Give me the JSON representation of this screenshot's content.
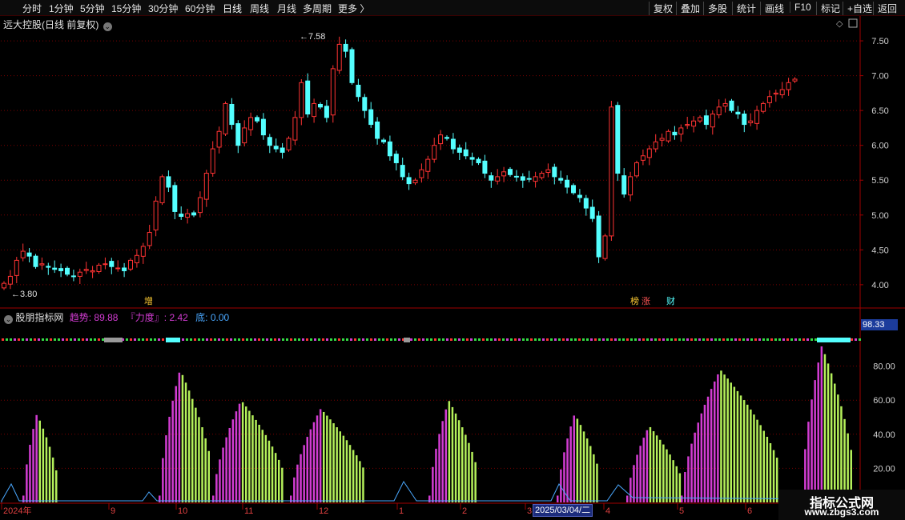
{
  "toolbar": {
    "periods": [
      "分时",
      "1分钟",
      "5分钟",
      "15分钟",
      "30分钟",
      "60分钟",
      "日线",
      "周线",
      "月线",
      "多周期",
      "更多 〉"
    ],
    "actions": [
      "复权",
      "叠加",
      "多股",
      "统计",
      "画线",
      "F10",
      "标记",
      "+自选",
      "返回"
    ]
  },
  "chart_header": {
    "title": "远大控股(日线 前复权)"
  },
  "price_axis": [
    "7.50",
    "7.00",
    "6.50",
    "6.00",
    "5.50",
    "5.00",
    "4.50",
    "4.00"
  ],
  "annotations": {
    "high": "7.58",
    "low": "3.80"
  },
  "markers": {
    "zeng": "增",
    "bang": "榜",
    "zhang": "涨",
    "cai": "财"
  },
  "indicator": {
    "name": "股朋指标网",
    "trend_label": "趋势:",
    "trend_value": "89.88",
    "force_label": "『力度』:",
    "force_value": "2.42",
    "bottom_label": "底:",
    "bottom_value": "0.00",
    "current_value": "98.33",
    "axis": [
      "80.00",
      "60.00",
      "40.00",
      "20.00"
    ]
  },
  "time_axis": [
    "2024年",
    "9",
    "10",
    "11",
    "12",
    "1",
    "2",
    "3",
    "4",
    "5",
    "6"
  ],
  "cursor_date": "2025/03/04/二",
  "watermark": {
    "line1": "指标公式网",
    "line2": "www.zbgs3.com"
  },
  "colors": {
    "up": "#ff3333",
    "down": "#54ffff",
    "magenta": "#d23cd2",
    "lime": "#b4f05a",
    "grid": "#7a0000"
  },
  "chart_data": {
    "type": "candlestick",
    "ylim": [
      3.7,
      7.65
    ],
    "closes": [
      4.02,
      4.12,
      4.35,
      4.48,
      4.41,
      4.26,
      4.3,
      4.25,
      4.22,
      4.2,
      4.15,
      4.12,
      4.18,
      4.22,
      4.2,
      4.28,
      4.3,
      4.26,
      4.24,
      4.2,
      4.35,
      4.42,
      4.55,
      4.75,
      5.2,
      5.55,
      5.4,
      5.05,
      4.98,
      5.02,
      5.0,
      5.25,
      5.6,
      5.95,
      6.2,
      6.6,
      6.3,
      6.0,
      6.25,
      6.4,
      6.35,
      6.15,
      6.0,
      5.95,
      5.9,
      6.1,
      6.4,
      6.9,
      6.45,
      6.6,
      6.55,
      6.4,
      7.1,
      7.45,
      7.35,
      6.9,
      6.7,
      6.5,
      6.3,
      6.1,
      6.05,
      5.85,
      5.75,
      5.55,
      5.45,
      5.5,
      5.65,
      5.8,
      6.0,
      6.15,
      6.1,
      5.95,
      5.9,
      5.85,
      5.8,
      5.75,
      5.6,
      5.5,
      5.55,
      5.62,
      5.58,
      5.55,
      5.5,
      5.52,
      5.55,
      5.6,
      5.65,
      5.55,
      5.5,
      5.4,
      5.32,
      5.25,
      5.1,
      4.95,
      4.4,
      4.7,
      6.55,
      5.6,
      5.3,
      5.55,
      5.75,
      5.85,
      5.95,
      6.05,
      6.1,
      6.2,
      6.15,
      6.25,
      6.3,
      6.35,
      6.4,
      6.3,
      6.45,
      6.55,
      6.6,
      6.5,
      6.45,
      6.3,
      6.35,
      6.5,
      6.6,
      6.7,
      6.75,
      6.8,
      6.9,
      6.95
    ]
  }
}
